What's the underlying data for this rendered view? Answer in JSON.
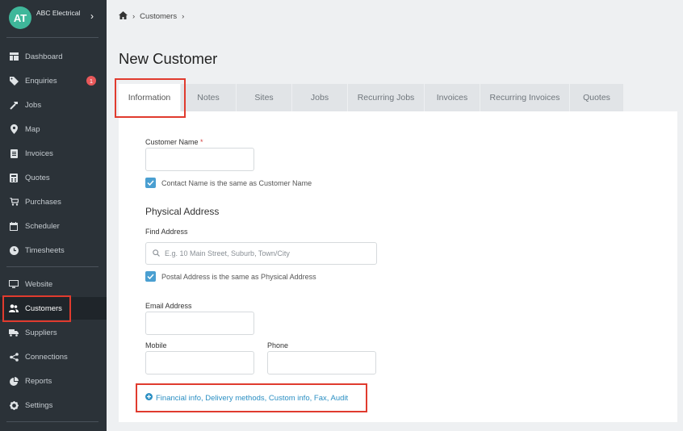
{
  "org": {
    "initials": "AT",
    "name": "ABC Electrical"
  },
  "sidebar": {
    "items": [
      {
        "label": "Dashboard"
      },
      {
        "label": "Enquiries",
        "badge": "1"
      },
      {
        "label": "Jobs"
      },
      {
        "label": "Map"
      },
      {
        "label": "Invoices"
      },
      {
        "label": "Quotes"
      },
      {
        "label": "Purchases"
      },
      {
        "label": "Scheduler"
      },
      {
        "label": "Timesheets"
      },
      {
        "label": "Website"
      },
      {
        "label": "Customers"
      },
      {
        "label": "Suppliers"
      },
      {
        "label": "Connections"
      },
      {
        "label": "Reports"
      },
      {
        "label": "Settings"
      }
    ]
  },
  "breadcrumb": {
    "current": "Customers"
  },
  "page": {
    "title": "New Customer"
  },
  "tabs": [
    "Information",
    "Notes",
    "Sites",
    "Jobs",
    "Recurring Jobs",
    "Invoices",
    "Recurring Invoices",
    "Quotes"
  ],
  "form": {
    "customer_name_label": "Customer Name",
    "required_mark": "*",
    "contact_same_label": "Contact Name is the same as Customer Name",
    "physical_address_title": "Physical Address",
    "find_address_label": "Find Address",
    "find_address_placeholder": "E.g. 10 Main Street, Suburb, Town/City",
    "postal_same_label": "Postal Address is the same as Physical Address",
    "email_label": "Email Address",
    "mobile_label": "Mobile",
    "phone_label": "Phone",
    "more_link": "Financial info, Delivery methods, Custom info, Fax, Audit"
  }
}
